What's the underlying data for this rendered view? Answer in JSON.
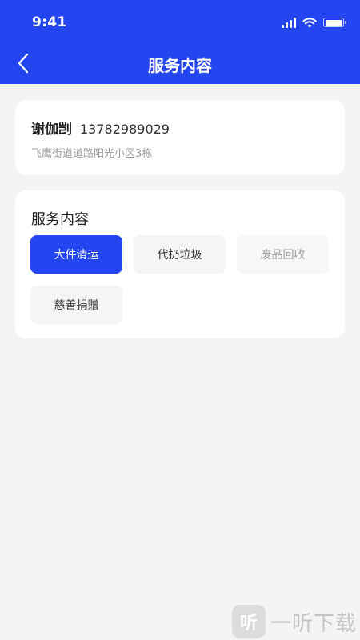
{
  "status_bar": {
    "time": "9:41"
  },
  "nav": {
    "back_icon": "chevron-left-icon",
    "title": "服务内容"
  },
  "contact": {
    "name": "谢伽剀",
    "phone": "13782989029",
    "address": "飞鹰街道道路阳光小区3栋"
  },
  "service": {
    "section_title": "服务内容",
    "options": [
      {
        "label": "大件清运",
        "state": "selected"
      },
      {
        "label": "代扔垃圾",
        "state": "normal"
      },
      {
        "label": "废品回收",
        "state": "disabled"
      },
      {
        "label": "慈善捐赠",
        "state": "normal"
      }
    ]
  },
  "watermark": {
    "logo_glyph": "听",
    "text": "一听下载"
  },
  "colors": {
    "primary": "#2446f0",
    "background": "#f4f4f4",
    "card": "#ffffff"
  }
}
